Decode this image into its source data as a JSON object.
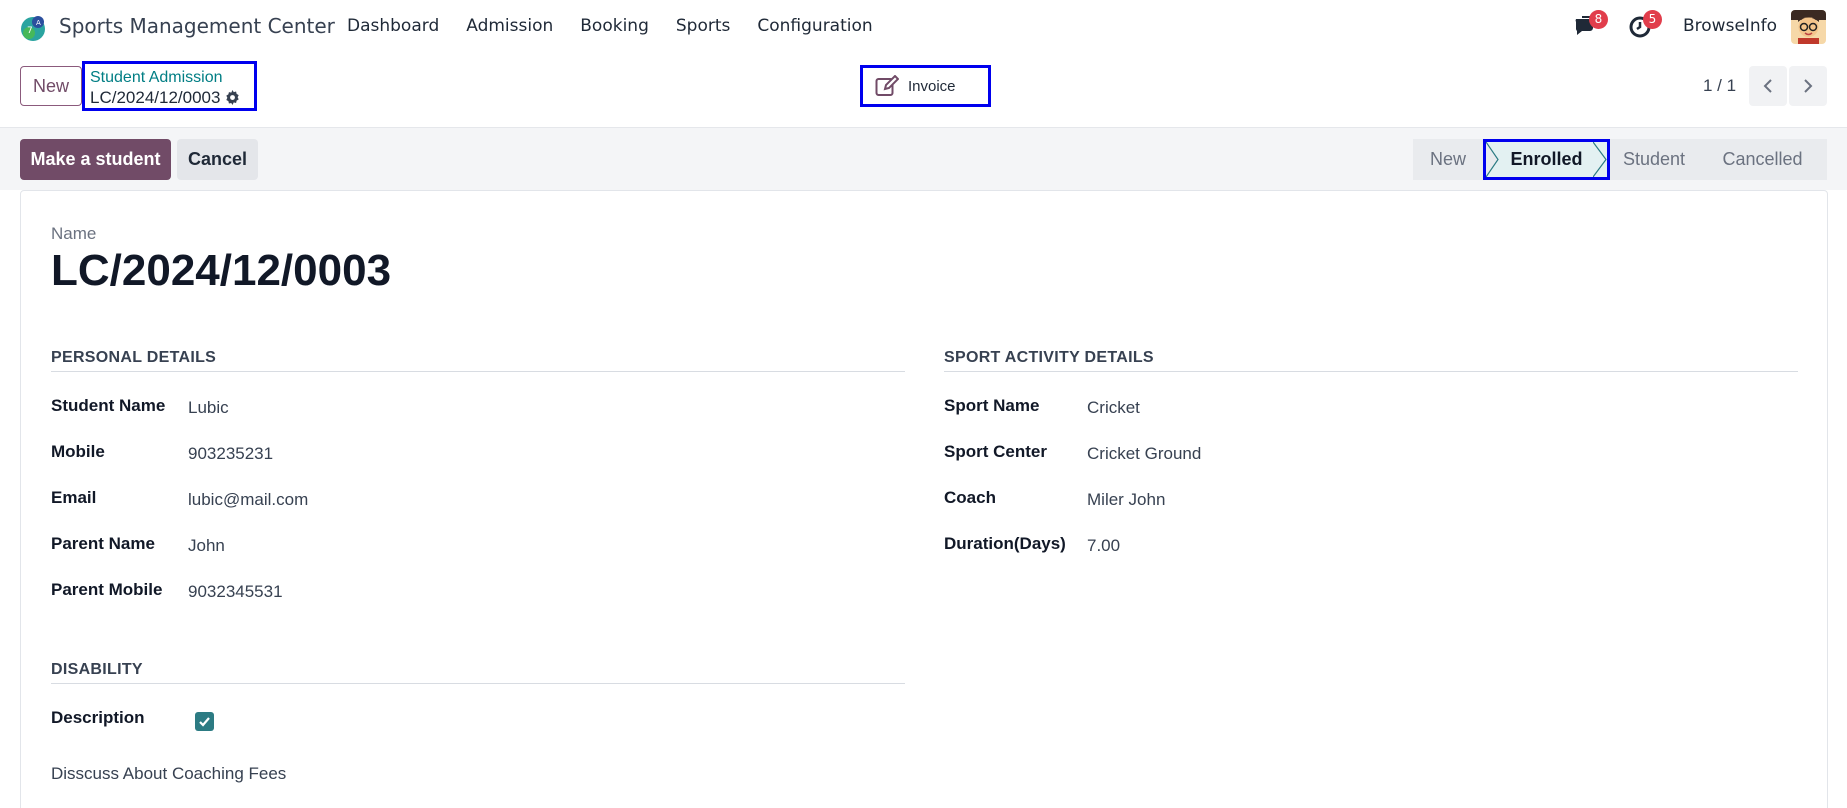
{
  "navbar": {
    "app_title": "Sports Management Center",
    "menu": [
      "Dashboard",
      "Admission",
      "Booking",
      "Sports",
      "Configuration"
    ],
    "messages_count": "8",
    "activities_count": "5",
    "company": "BrowseInfo"
  },
  "control_panel": {
    "new_label": "New",
    "breadcrumb_parent": "Student Admission",
    "breadcrumb_current": "LC/2024/12/0003",
    "invoice_label": "Invoice",
    "pager": "1 / 1"
  },
  "statusbar": {
    "primary_button": "Make a student",
    "cancel_button": "Cancel",
    "stages": [
      "New",
      "Enrolled",
      "Student",
      "Cancelled"
    ],
    "active_stage": "Enrolled"
  },
  "form": {
    "name_label": "Name",
    "name_value": "LC/2024/12/0003",
    "personal": {
      "title": "PERSONAL DETAILS",
      "fields": [
        {
          "label": "Student Name",
          "value": "Lubic"
        },
        {
          "label": "Mobile",
          "value": "903235231"
        },
        {
          "label": "Email",
          "value": "lubic@mail.com"
        },
        {
          "label": "Parent Name",
          "value": "John"
        },
        {
          "label": "Parent Mobile",
          "value": "9032345531"
        }
      ]
    },
    "sport": {
      "title": "SPORT ACTIVITY DETAILS",
      "fields": [
        {
          "label": "Sport Name",
          "value": "Cricket"
        },
        {
          "label": "Sport Center",
          "value": "Cricket Ground"
        },
        {
          "label": "Coach",
          "value": "Miler John"
        },
        {
          "label": "Duration(Days)",
          "value": "7.00"
        }
      ]
    },
    "disability": {
      "title": "DISABILITY",
      "description_label": "Description",
      "description_checked": true,
      "description_text": "Disscuss About Coaching Fees"
    }
  },
  "colors": {
    "brand": "#714B67",
    "teal": "#017e84",
    "highlight_border": "#0000ee",
    "badge": "#e13d4b"
  }
}
